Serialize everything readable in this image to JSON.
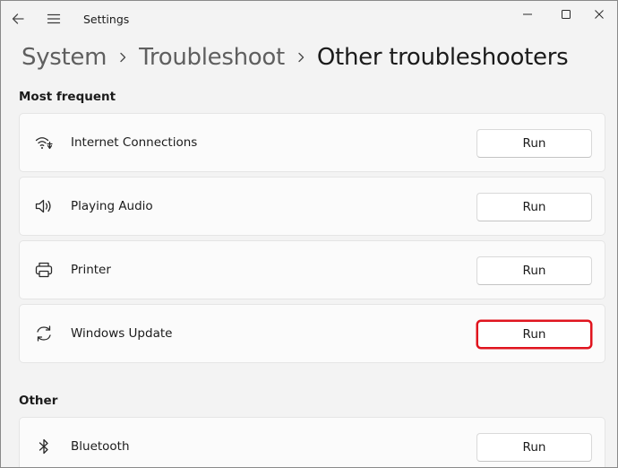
{
  "window": {
    "app_title": "Settings"
  },
  "breadcrumb": {
    "items": [
      "System",
      "Troubleshoot"
    ],
    "current": "Other troubleshooters"
  },
  "sections": {
    "most_frequent": {
      "header": "Most frequent",
      "items": [
        {
          "label": "Internet Connections",
          "icon": "wifi-icon",
          "button": "Run"
        },
        {
          "label": "Playing Audio",
          "icon": "speaker-icon",
          "button": "Run"
        },
        {
          "label": "Printer",
          "icon": "printer-icon",
          "button": "Run"
        },
        {
          "label": "Windows Update",
          "icon": "sync-icon",
          "button": "Run",
          "highlighted": true
        }
      ]
    },
    "other": {
      "header": "Other",
      "items": [
        {
          "label": "Bluetooth",
          "icon": "bluetooth-icon",
          "button": "Run"
        }
      ]
    }
  },
  "colors": {
    "background": "#f3f3f3",
    "card": "#fbfbfb",
    "highlight": "#e0141e"
  }
}
